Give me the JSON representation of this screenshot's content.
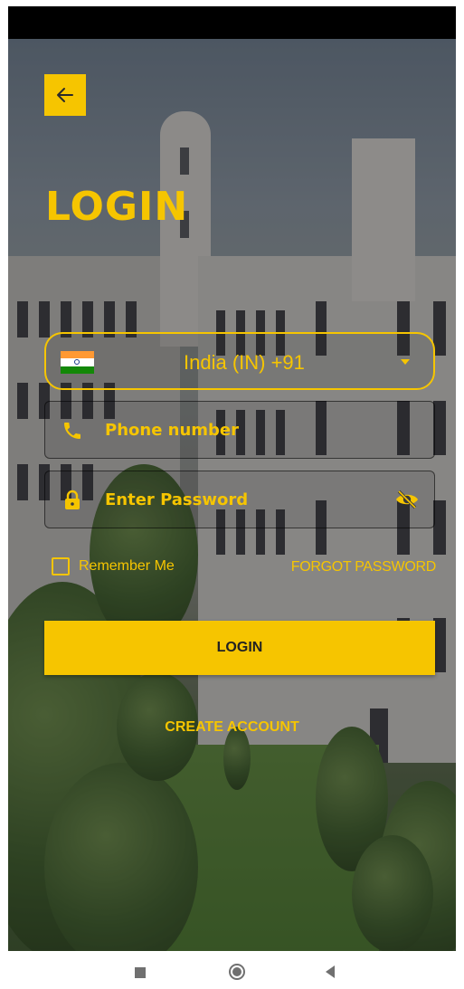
{
  "title": "LOGIN",
  "country_select": {
    "label": "India (IN)  +91",
    "flag_icon": "india-flag-icon"
  },
  "phone_field": {
    "placeholder": "Phone number",
    "icon": "phone-icon"
  },
  "password_field": {
    "placeholder": "Enter Password",
    "icon": "lock-icon",
    "toggle_icon": "eye-off-icon"
  },
  "remember_me": {
    "label": "Remember Me",
    "checked": false
  },
  "forgot_password_label": "FORGOT PASSWORD",
  "login_button_label": "LOGIN",
  "create_account_label": "CREATE ACCOUNT",
  "colors": {
    "accent": "#f6c500",
    "button_text": "#222222"
  },
  "nav_bar": {
    "icons": [
      "recent-apps-icon",
      "home-icon",
      "back-icon"
    ]
  }
}
